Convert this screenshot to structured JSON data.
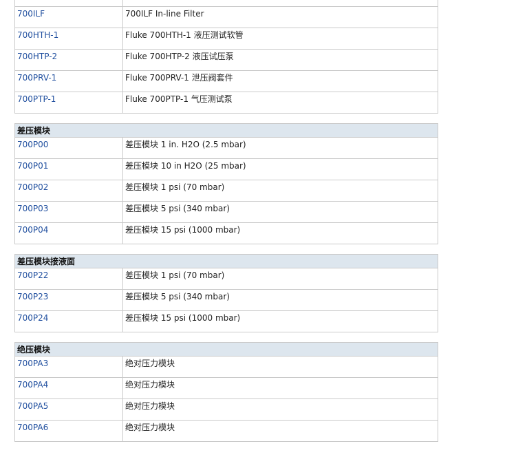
{
  "top_rows": [
    {
      "code": "700ILF",
      "desc": "700ILF In-line Filter"
    },
    {
      "code": "700HTH-1",
      "desc": "Fluke 700HTH-1 液压测试软管"
    },
    {
      "code": "700HTP-2",
      "desc": "Fluke 700HTP-2 液压试压泵"
    },
    {
      "code": "700PRV-1",
      "desc": "Fluke 700PRV-1 泄压阀套件"
    },
    {
      "code": "700PTP-1",
      "desc": "Fluke 700PTP-1 气压测试泵"
    }
  ],
  "sections": [
    {
      "title": "差压模块",
      "rows": [
        {
          "code": "700P00",
          "desc": "差压模块 1 in. H2O (2.5 mbar)"
        },
        {
          "code": "700P01",
          "desc": "差压模块 10 in H2O (25 mbar)"
        },
        {
          "code": "700P02",
          "desc": "差压模块 1 psi (70 mbar)"
        },
        {
          "code": "700P03",
          "desc": "差压模块 5 psi (340 mbar)"
        },
        {
          "code": "700P04",
          "desc": "差压模块 15 psi (1000 mbar)"
        }
      ]
    },
    {
      "title": "差压模块接液面",
      "rows": [
        {
          "code": "700P22",
          "desc": "差压模块 1 psi (70 mbar)"
        },
        {
          "code": "700P23",
          "desc": "差压模块 5 psi (340 mbar)"
        },
        {
          "code": "700P24",
          "desc": "差压模块 15 psi (1000 mbar)"
        }
      ]
    },
    {
      "title": "绝压模块",
      "rows": [
        {
          "code": "700PA3",
          "desc": "绝对压力模块"
        },
        {
          "code": "700PA4",
          "desc": "绝对压力模块"
        },
        {
          "code": "700PA5",
          "desc": "绝对压力模块"
        },
        {
          "code": "700PA6",
          "desc": "绝对压力模块"
        }
      ]
    }
  ]
}
